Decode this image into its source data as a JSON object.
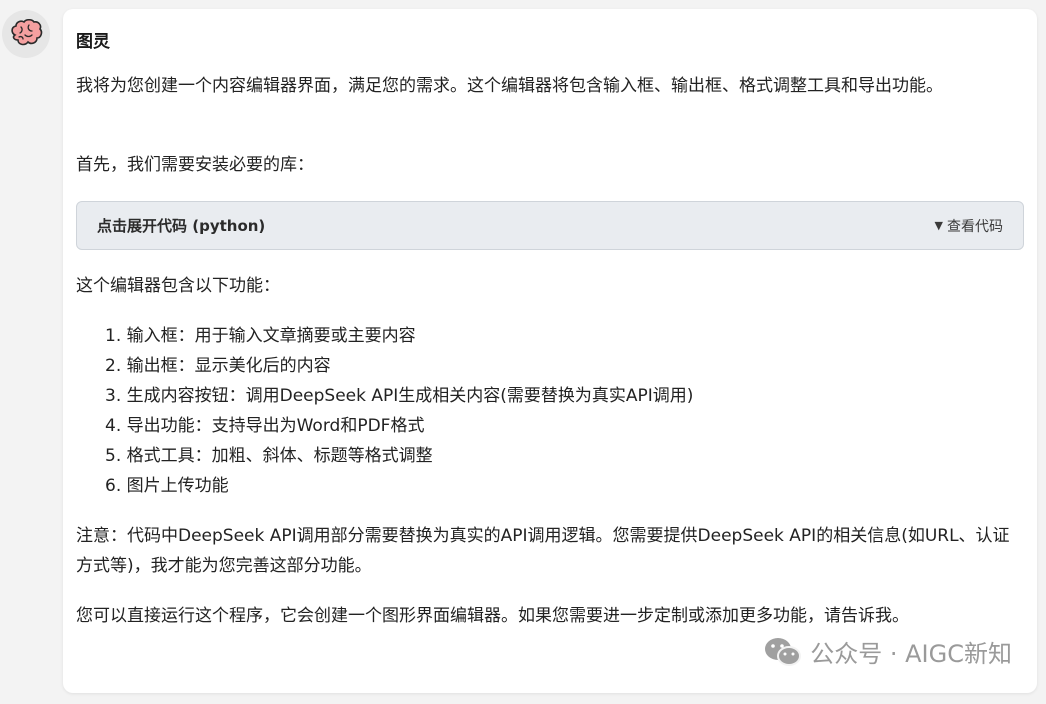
{
  "message": {
    "sender": "图灵",
    "intro": "我将为您创建一个内容编辑器界面，满足您的需求。这个编辑器将包含输入框、输出框、格式调整工具和导出功能。",
    "install_note": "首先，我们需要安装必要的库：",
    "code_block": {
      "title": "点击展开代码 (python)",
      "toggle_icon": "▼",
      "toggle_label": "查看代码"
    },
    "features_intro": "这个编辑器包含以下功能：",
    "features": [
      "1. 输入框：用于输入文章摘要或主要内容",
      "2. 输出框：显示美化后的内容",
      "3. 生成内容按钮：调用DeepSeek API生成相关内容(需要替换为真实API调用)",
      "4. 导出功能：支持导出为Word和PDF格式",
      "5. 格式工具：加粗、斜体、标题等格式调整",
      "6. 图片上传功能"
    ],
    "note": "注意：代码中DeepSeek API调用部分需要替换为真实的API调用逻辑。您需要提供DeepSeek API的相关信息(如URL、认证方式等)，我才能为您完善这部分功能。",
    "closing": "您可以直接运行这个程序，它会创建一个图形界面编辑器。如果您需要进一步定制或添加更多功能，请告诉我。"
  },
  "watermark": {
    "icon": "wechat-icon",
    "text": "公众号 · AIGC新知"
  },
  "colors": {
    "avatar_brain": "#f08a8a",
    "code_block_bg": "#e9ecf0"
  }
}
